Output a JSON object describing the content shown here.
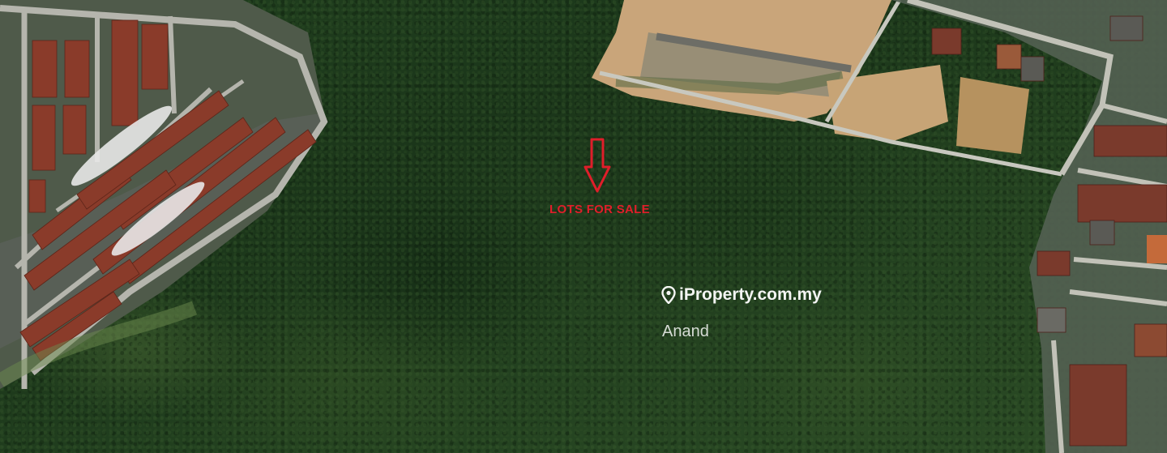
{
  "annotation": {
    "label": "LOTS FOR SALE",
    "color": "#e01e2a",
    "marker_icon": "down-arrow-icon"
  },
  "watermark": {
    "brand": "iProperty.com.my",
    "agent": "Anand",
    "brand_icon": "location-pin-icon"
  },
  "scene": {
    "kind": "aerial-satellite-view",
    "features": [
      "forest",
      "terraced-housing",
      "cleared-land",
      "road"
    ],
    "colors": {
      "forest": "#1f3a1c",
      "roofs": "#8a3b2a",
      "cleared_soil": "#c9a57a",
      "road": "#b9b9b0"
    }
  }
}
